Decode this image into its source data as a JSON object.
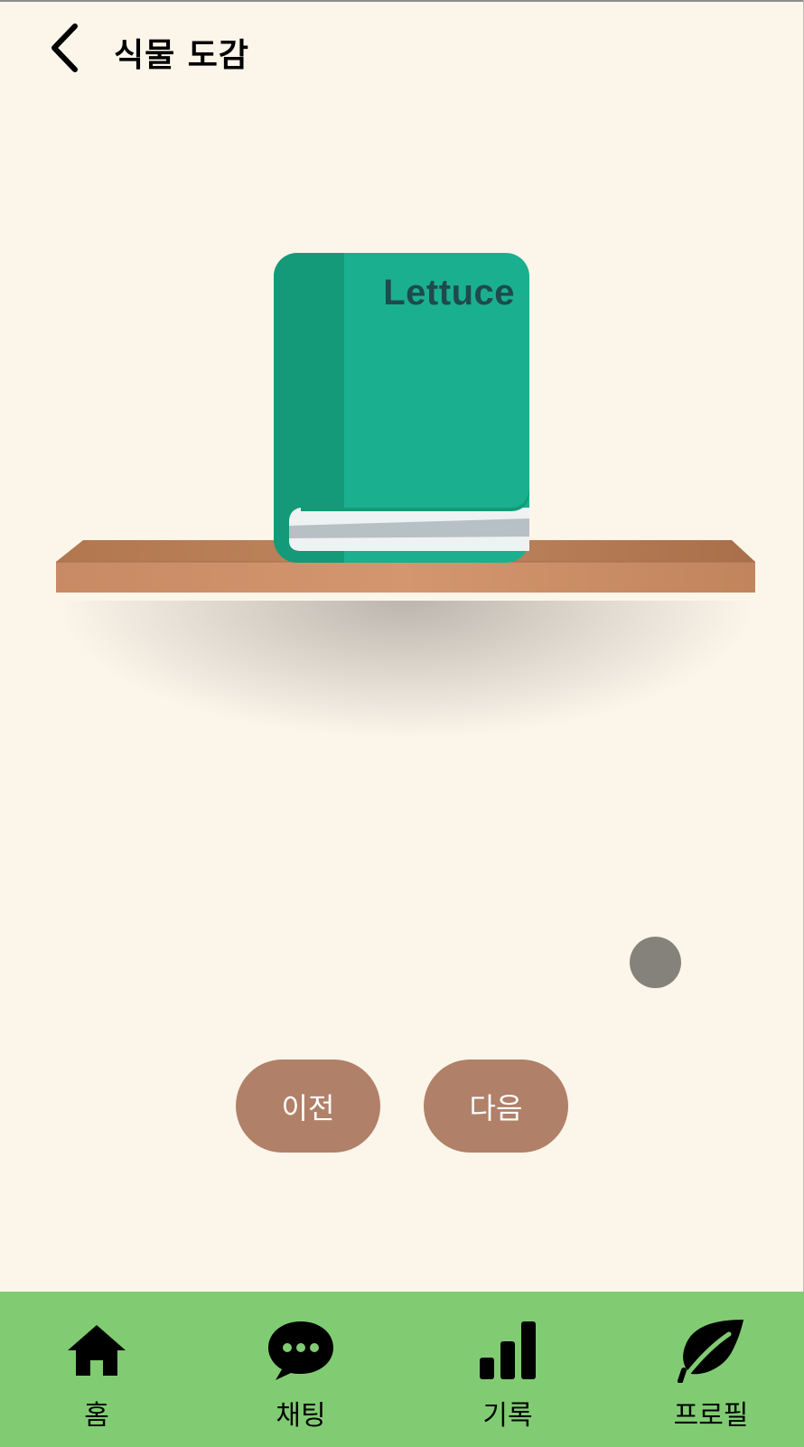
{
  "header": {
    "title": "식물 도감",
    "back_icon": "chevron-left-icon"
  },
  "book": {
    "title": "Lettuce",
    "cover_color": "#1ab08f",
    "spine_color": "#149a78"
  },
  "controls": {
    "prev_label": "이전",
    "next_label": "다음",
    "button_color": "#b08068"
  },
  "bottom_nav": {
    "background": "#81cc73",
    "items": [
      {
        "label": "홈",
        "icon": "home-icon"
      },
      {
        "label": "채팅",
        "icon": "chat-bubble-icon"
      },
      {
        "label": "기록",
        "icon": "bar-chart-icon"
      },
      {
        "label": "프로필",
        "icon": "leaf-icon"
      }
    ]
  }
}
